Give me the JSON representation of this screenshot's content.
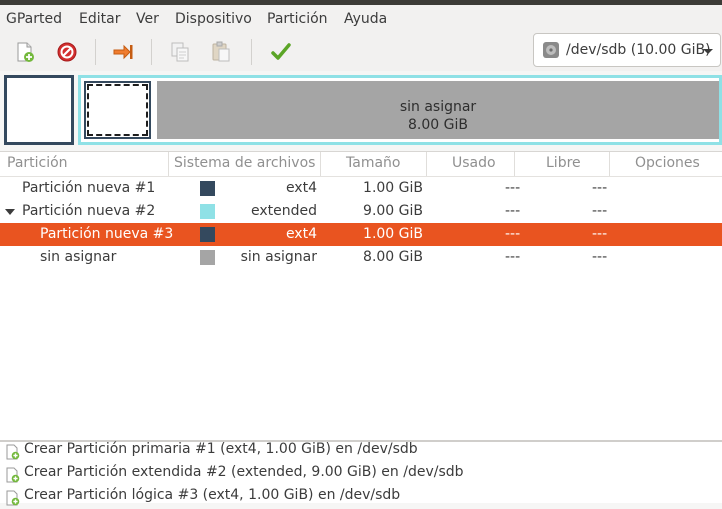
{
  "menu": {
    "items": [
      {
        "label": "GParted"
      },
      {
        "label": "Editar"
      },
      {
        "label": "Ver"
      },
      {
        "label": "Dispositivo"
      },
      {
        "label": "Partición"
      },
      {
        "label": "Ayuda"
      }
    ]
  },
  "toolbar": {
    "buttons": [
      {
        "icon": "new-partition-icon"
      },
      {
        "icon": "delete-icon"
      },
      {
        "icon": "resize-move-icon"
      },
      {
        "icon": "copy-icon"
      },
      {
        "icon": "paste-icon"
      },
      {
        "icon": "apply-checkmark-icon"
      }
    ]
  },
  "device": {
    "selected": "/dev/sdb (10.00 GiB)",
    "icon": "disk-icon"
  },
  "diskmap": {
    "unallocated_label": "sin asignar",
    "unallocated_size": "8.00 GiB"
  },
  "table": {
    "headers": {
      "partition": "Partición",
      "filesystem": "Sistema de archivos",
      "size": "Tamaño",
      "used": "Usado",
      "free": "Libre",
      "options": "Opciones"
    },
    "rows": [
      {
        "name": "Partición nueva #1",
        "color": "#34495e",
        "fs": "ext4",
        "size": "1.00 GiB",
        "used": "---",
        "free": "---"
      },
      {
        "name": "Partición nueva #2",
        "color": "#8fe1e6",
        "fs": "extended",
        "size": "9.00 GiB",
        "used": "---",
        "free": "---"
      },
      {
        "name": "Partición nueva #3",
        "color": "#34495e",
        "fs": "ext4",
        "size": "1.00 GiB",
        "used": "---",
        "free": "---"
      },
      {
        "name": "sin asignar",
        "color": "#a5a5a5",
        "fs": "sin asignar",
        "size": "8.00 GiB",
        "used": "---",
        "free": "---"
      }
    ]
  },
  "operations": [
    {
      "text": "Crear Partición primaria #1 (ext4, 1.00 GiB) en /dev/sdb"
    },
    {
      "text": "Crear Partición extendida #2 (extended, 9.00 GiB) en /dev/sdb"
    },
    {
      "text": "Crear Partición lógica #3 (ext4, 1.00 GiB) en /dev/sdb"
    }
  ],
  "colors": {
    "accent": "#e95420",
    "ext4": "#34495e",
    "extended": "#8fe1e6",
    "unallocated": "#a5a5a5"
  }
}
